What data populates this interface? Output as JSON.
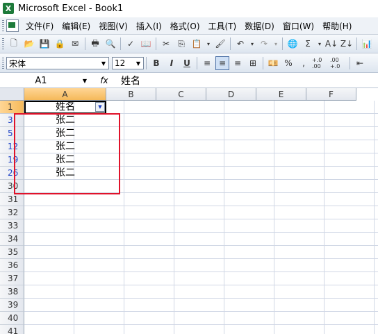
{
  "app": {
    "title": "Microsoft Excel - Book1",
    "icon": "excel-logo-icon"
  },
  "menu": [
    "文件(F)",
    "编辑(E)",
    "视图(V)",
    "插入(I)",
    "格式(O)",
    "工具(T)",
    "数据(D)",
    "窗口(W)",
    "帮助(H)"
  ],
  "format_toolbar": {
    "font_name": "宋体",
    "font_size": "12",
    "bold": "B",
    "italic": "I",
    "underline": "U",
    "percent": "%",
    "comma": ",",
    "increase_decimal": "+.0 .00",
    "decrease_decimal": ".00 +.0"
  },
  "formula_bar": {
    "name_box": "A1",
    "fx_label": "fx",
    "content": "姓名"
  },
  "columns": [
    "A",
    "B",
    "C",
    "D",
    "E",
    "F"
  ],
  "selected_column": "A",
  "rows": [
    {
      "num": "1",
      "a": "姓名",
      "selected": true
    },
    {
      "num": "3",
      "a": "张二",
      "filtered": true
    },
    {
      "num": "5",
      "a": "张二",
      "filtered": true
    },
    {
      "num": "12",
      "a": "张二",
      "filtered": true
    },
    {
      "num": "19",
      "a": "张二",
      "filtered": true
    },
    {
      "num": "26",
      "a": "张二",
      "filtered": true
    },
    {
      "num": "30",
      "a": ""
    },
    {
      "num": "31",
      "a": ""
    },
    {
      "num": "32",
      "a": ""
    },
    {
      "num": "33",
      "a": ""
    },
    {
      "num": "34",
      "a": ""
    },
    {
      "num": "35",
      "a": ""
    },
    {
      "num": "36",
      "a": ""
    },
    {
      "num": "37",
      "a": ""
    },
    {
      "num": "38",
      "a": ""
    },
    {
      "num": "39",
      "a": ""
    },
    {
      "num": "40",
      "a": ""
    },
    {
      "num": "41",
      "a": ""
    }
  ],
  "highlight_color": "#e0122a",
  "filter_row_color": "#1a3ec5"
}
